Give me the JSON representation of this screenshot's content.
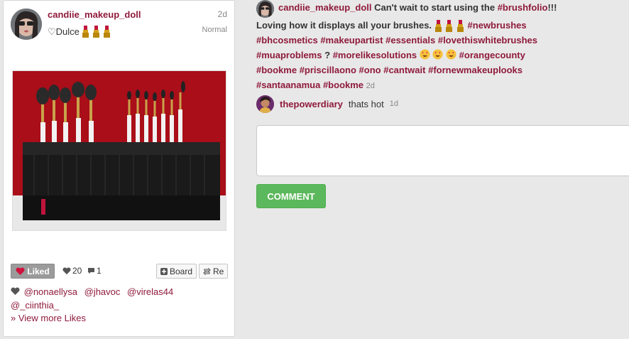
{
  "post": {
    "username": "candiie_makeup_doll",
    "time": "2d",
    "subtitle": "♡Dulce",
    "filter": "Normal",
    "likes_count": "20",
    "comments_count": "1",
    "liked_label": "Liked",
    "board_label": "Board",
    "repost_label": "Re",
    "likers": [
      "@nonaellysa",
      "@jhavoc",
      "@virelas44",
      "@_ciinthia_"
    ],
    "view_more_label": "» View more Likes"
  },
  "caption": {
    "username": "candiie_makeup_doll",
    "text_1": "Can't wait to start using the",
    "tag_brushfolio": "#brushfolio",
    "text_2": "!!!",
    "text_3": "Loving how it displays all your brushes.",
    "tags_a": [
      "#newbrushes",
      "#bhcosmetics",
      "#makeupartist",
      "#essentials",
      "#lovethiswhitebrushes",
      "#muaproblems"
    ],
    "text_4": "?",
    "tag_morelike": "#morelikesolutions",
    "tags_b": [
      "#orangecounty",
      "#bookme",
      "#priscillaono",
      "#ono",
      "#cantwait",
      "#fornewmakeuplooks",
      "#santaanamua",
      "#bookme"
    ],
    "time": "2d"
  },
  "comments": [
    {
      "username": "thepowerdiary",
      "text": "thats hot",
      "time": "1d"
    }
  ],
  "comment_input": {
    "value": "",
    "placeholder": ""
  },
  "comment_button_label": "COMMENT",
  "colors": {
    "link": "#8f1a3c",
    "comment_button": "#5cb85c",
    "liked_button": "#9b9b9b"
  },
  "icons": [
    "lipstick-icon",
    "heart-icon",
    "comment-icon",
    "plus-icon",
    "repost-icon",
    "heart-eyes-icon"
  ]
}
